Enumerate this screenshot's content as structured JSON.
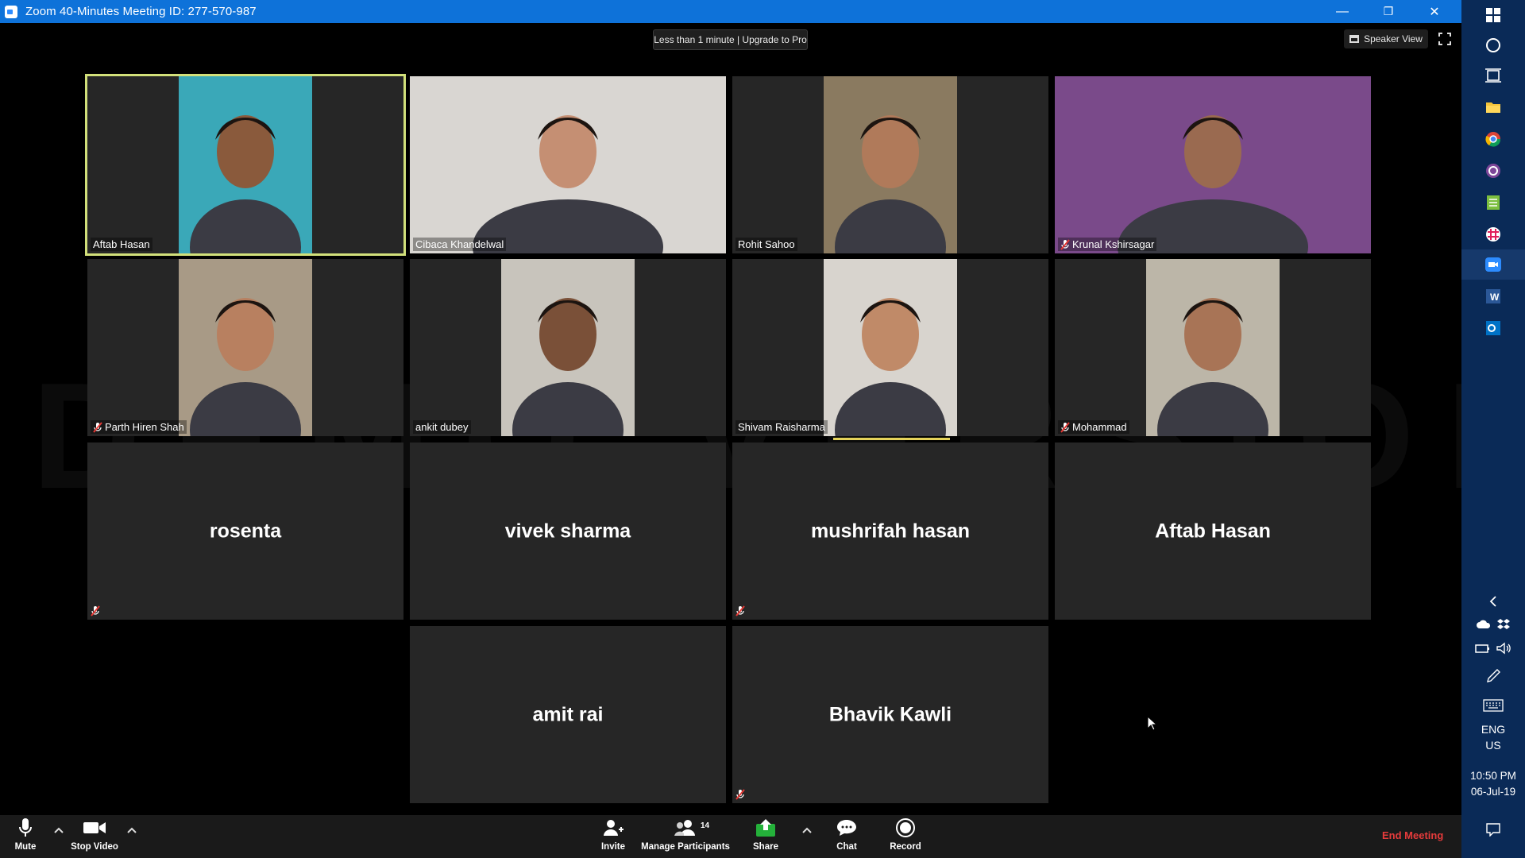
{
  "window": {
    "title": "Zoom 40-Minutes Meeting ID: 277-570-987",
    "minimize_glyph": "—",
    "restore_glyph": "❐",
    "close_glyph": "✕"
  },
  "topbar": {
    "trial_banner": "Less than 1 minute | Upgrade to Pro",
    "speaker_view_label": "Speaker View"
  },
  "watermark": "DEMO VERSION",
  "participants": [
    {
      "name": "Aftab Hasan",
      "video": true,
      "muted": false,
      "active_speaker": true,
      "skin": "#8a5a3c",
      "bg": "#3aa8b8"
    },
    {
      "name": "Cibaca Khandelwal",
      "video": true,
      "muted": false,
      "skin": "#c58f73",
      "bg": "#d9d6d2"
    },
    {
      "name": "Rohit Sahoo",
      "video": true,
      "muted": false,
      "skin": "#b07a5a",
      "bg": "#8a7a60"
    },
    {
      "name": "Krunal Kshirsagar",
      "video": true,
      "muted": true,
      "skin": "#9a6a50",
      "bg": "#7a4a8a"
    },
    {
      "name": "Parth Hiren Shah",
      "video": true,
      "muted": true,
      "skin": "#b88060",
      "bg": "#a89a86"
    },
    {
      "name": "ankit dubey",
      "video": true,
      "muted": false,
      "skin": "#7a5038",
      "bg": "#c8c4bc"
    },
    {
      "name": "Shivam Raisharma",
      "video": true,
      "muted": false,
      "skin": "#c08a68",
      "bg": "#d8d4ce"
    },
    {
      "name": "Mohammad",
      "video": true,
      "muted": true,
      "skin": "#a87456",
      "bg": "#bcb6a8"
    },
    {
      "name": "rosenta",
      "video": false,
      "muted": true
    },
    {
      "name": "vivek sharma",
      "video": false,
      "muted": false
    },
    {
      "name": "mushrifah hasan",
      "video": false,
      "muted": true
    },
    {
      "name": "Aftab Hasan",
      "video": false,
      "muted": false
    },
    {
      "name": "amit rai",
      "video": false,
      "muted": false
    },
    {
      "name": "Bhavik Kawli",
      "video": false,
      "muted": true
    }
  ],
  "toolbar": {
    "mute_label": "Mute",
    "stop_video_label": "Stop Video",
    "invite_label": "Invite",
    "participants_label": "Manage Participants",
    "participants_count": "14",
    "share_label": "Share",
    "chat_label": "Chat",
    "record_label": "Record",
    "end_meeting_label": "End Meeting"
  },
  "taskbar": {
    "language_line1": "ENG",
    "language_line2": "US",
    "time": "10:50 PM",
    "date": "06-Jul-19"
  },
  "colors": {
    "title_bar": "#0e72d9",
    "active_speaker_border": "#d2e07a",
    "end_meeting": "#e63b3b",
    "share_green": "#24b13a",
    "taskbar_bg": "#0a2a57"
  }
}
